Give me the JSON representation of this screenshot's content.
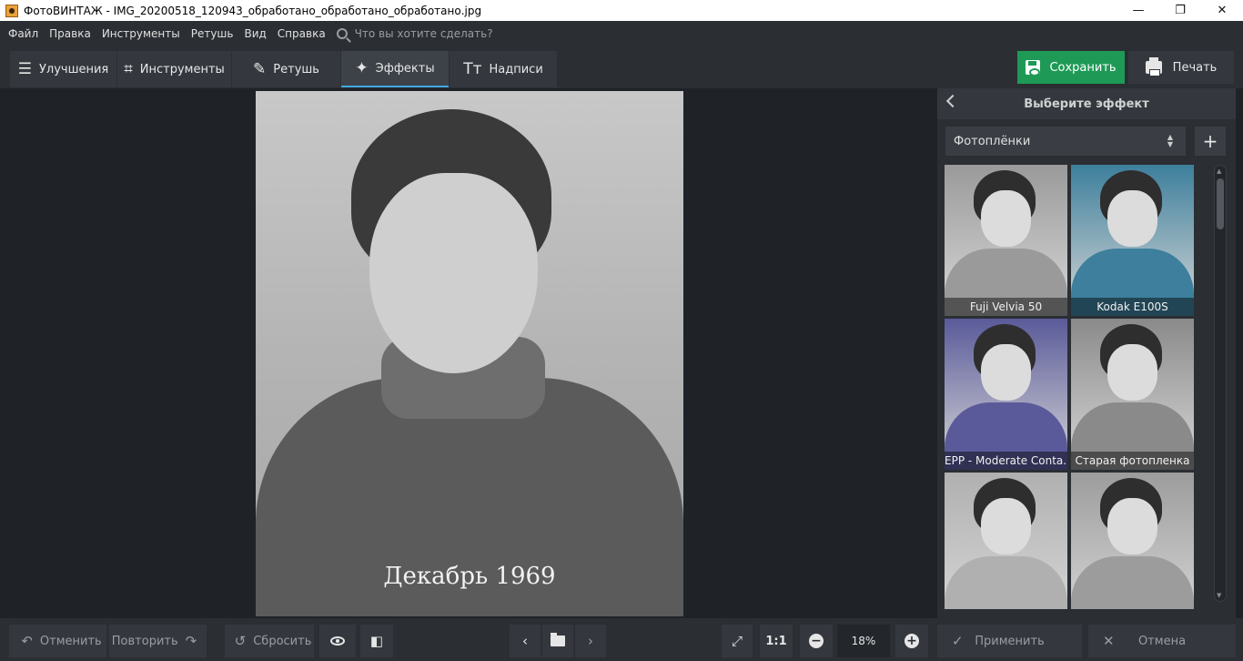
{
  "window": {
    "title": "ФотоВИНТАЖ - IMG_20200518_120943_обработано_обработано_обработано.jpg",
    "minimize": "—",
    "maximize": "❐",
    "close": "✕"
  },
  "menu": {
    "items": [
      "Файл",
      "Правка",
      "Инструменты",
      "Ретушь",
      "Вид",
      "Справка"
    ],
    "search_placeholder": "Что вы хотите сделать?"
  },
  "tabs": [
    {
      "label": "Улучшения",
      "icon": "sliders-icon",
      "glyph": "☰",
      "active": false
    },
    {
      "label": "Инструменты",
      "icon": "crop-icon",
      "glyph": "⌗",
      "active": false
    },
    {
      "label": "Ретушь",
      "icon": "brush-icon",
      "glyph": "✎",
      "active": false
    },
    {
      "label": "Эффекты",
      "icon": "magic-wand-icon",
      "glyph": "✦",
      "active": true
    },
    {
      "label": "Надписи",
      "icon": "text-icon",
      "glyph": "Tт",
      "active": false
    }
  ],
  "actions": {
    "save_label": "Сохранить",
    "print_label": "Печать",
    "save_color": "#1e9a56"
  },
  "photo": {
    "caption": "Декабрь 1969"
  },
  "panel": {
    "title": "Выберите эффект",
    "category": "Фотоплёнки",
    "add_symbol": "+",
    "effects": [
      {
        "label": "Fuji Velvia 50",
        "tint": "#9a9a9a"
      },
      {
        "label": "Kodak E100S",
        "tint": "#3d7f9c"
      },
      {
        "label": "EPP - Moderate Conta...",
        "tint": "#5a5a9a"
      },
      {
        "label": "Старая фотопленка",
        "tint": "#8a8a8a"
      },
      {
        "label": "",
        "tint": "#b0b0b0"
      },
      {
        "label": "",
        "tint": "#9c9c9c"
      }
    ]
  },
  "bottom": {
    "undo_label": "Отменить",
    "redo_label": "Повторить",
    "reset_label": "Сбросить",
    "actual_size": "1:1",
    "zoom": "18%",
    "apply_label": "Применить",
    "cancel_label": "Отмена"
  }
}
